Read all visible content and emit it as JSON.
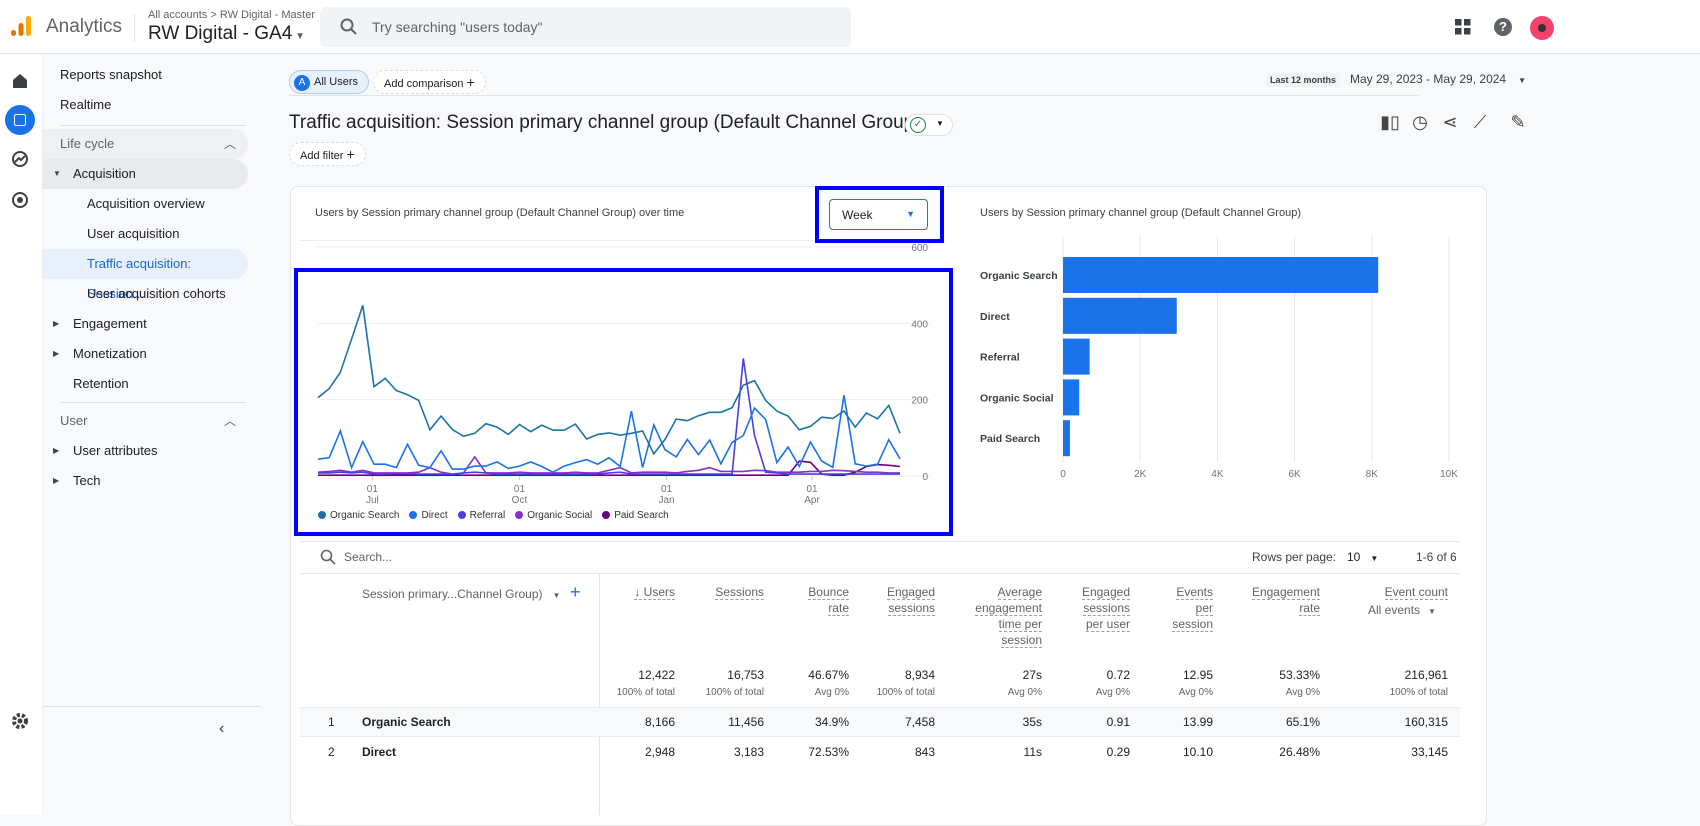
{
  "header": {
    "app_name": "Analytics",
    "breadcrumb": "All accounts > RW Digital - Master",
    "property": "RW Digital - GA4",
    "search_placeholder": "Try searching \"users today\"",
    "icons": [
      "apps-grid-icon",
      "help-icon",
      "avatar"
    ]
  },
  "sidebar": {
    "items": [
      {
        "label": "Reports snapshot"
      },
      {
        "label": "Realtime"
      },
      {
        "label": "Life cycle"
      },
      {
        "label": "Acquisition"
      },
      {
        "label": "Acquisition overview"
      },
      {
        "label": "User acquisition"
      },
      {
        "label": "Traffic acquisition: Session..."
      },
      {
        "label": "User acquisition cohorts"
      },
      {
        "label": "Engagement"
      },
      {
        "label": "Monetization"
      },
      {
        "label": "Retention"
      },
      {
        "label": "User"
      },
      {
        "label": "User attributes"
      },
      {
        "label": "Tech"
      }
    ],
    "collapse_icon": "chevron-left-icon"
  },
  "toolbar": {
    "segment_letter": "A",
    "segment": "All Users",
    "add_comparison": "Add comparison",
    "date_chip": "Last 12 months",
    "date_range": "May 29, 2023 - May 29, 2024"
  },
  "report": {
    "title": "Traffic acquisition: Session primary channel group (Default Channel Group)",
    "add_filter": "Add filter"
  },
  "line_chart_title": "Users by Session primary channel group (Default Channel Group) over time",
  "interval_select": "Week",
  "bar_chart_title": "Users by Session primary channel group (Default Channel Group)",
  "chart_data": [
    {
      "type": "line",
      "ylim": [
        0,
        600
      ],
      "yticks": [
        "0",
        "200",
        "400",
        "600"
      ],
      "xticks": [
        {
          "day": "01",
          "month": "Jul",
          "date": "2023-07-01"
        },
        {
          "day": "01",
          "month": "Oct",
          "date": "2023-10-01"
        },
        {
          "day": "01",
          "month": "Jan",
          "date": "2024-01-01"
        },
        {
          "day": "01",
          "month": "Apr",
          "date": "2024-04-01"
        }
      ],
      "x_start": "2023-05-28",
      "x_interval": "week",
      "grid": true,
      "legend": "bottom",
      "series": [
        {
          "name": "Organic Search",
          "color": "#1a73a8",
          "values": [
            205,
            229,
            272,
            359,
            447,
            234,
            256,
            224,
            213,
            198,
            121,
            157,
            122,
            104,
            112,
            137,
            128,
            109,
            135,
            116,
            133,
            120,
            120,
            136,
            97,
            109,
            113,
            107,
            112,
            118,
            58,
            96,
            149,
            145,
            158,
            167,
            167,
            179,
            238,
            250,
            198,
            170,
            157,
            121,
            130,
            154,
            151,
            170,
            128,
            165,
            150,
            185,
            112
          ]
        },
        {
          "name": "Direct",
          "color": "#1a73e8",
          "values": [
            44,
            48,
            118,
            22,
            90,
            31,
            31,
            22,
            83,
            28,
            22,
            66,
            18,
            18,
            26,
            26,
            37,
            20,
            26,
            37,
            25,
            10,
            26,
            35,
            43,
            31,
            48,
            25,
            170,
            22,
            134,
            69,
            50,
            96,
            56,
            94,
            32,
            88,
            106,
            178,
            148,
            35,
            76,
            25,
            89,
            39,
            23,
            212,
            32,
            26,
            31,
            95,
            45
          ]
        },
        {
          "name": "Referral",
          "color": "#4a3fe0",
          "values": [
            8,
            8,
            10,
            8,
            10,
            5,
            5,
            6,
            6,
            5,
            5,
            5,
            4,
            8,
            10,
            8,
            5,
            5,
            5,
            5,
            5,
            5,
            5,
            5,
            5,
            5,
            8,
            10,
            5,
            5,
            5,
            5,
            5,
            5,
            5,
            5,
            5,
            5,
            308,
            106,
            10,
            8,
            5,
            5,
            5,
            5,
            5,
            5,
            5,
            5,
            5,
            5,
            5
          ]
        },
        {
          "name": "Organic Social",
          "color": "#8430ce",
          "values": [
            10,
            12,
            15,
            10,
            15,
            8,
            8,
            8,
            8,
            10,
            22,
            10,
            5,
            8,
            50,
            8,
            8,
            8,
            10,
            8,
            8,
            8,
            8,
            10,
            8,
            8,
            15,
            22,
            8,
            10,
            10,
            10,
            8,
            12,
            15,
            22,
            12,
            12,
            12,
            15,
            14,
            10,
            10,
            10,
            12,
            12,
            15,
            14,
            12,
            10,
            10,
            8,
            8
          ]
        },
        {
          "name": "Paid Search",
          "color": "#6a0080",
          "values": [
            2,
            2,
            2,
            2,
            2,
            2,
            2,
            2,
            2,
            2,
            2,
            2,
            2,
            2,
            2,
            2,
            2,
            2,
            2,
            2,
            2,
            2,
            2,
            2,
            2,
            2,
            2,
            2,
            2,
            2,
            2,
            2,
            2,
            2,
            2,
            2,
            2,
            2,
            2,
            2,
            2,
            2,
            2,
            39,
            36,
            5,
            2,
            2,
            10,
            25,
            30,
            28,
            25
          ]
        }
      ]
    },
    {
      "type": "bar",
      "orientation": "horizontal",
      "xlim": [
        0,
        10000
      ],
      "xticks": [
        "0",
        "2K",
        "4K",
        "6K",
        "8K",
        "10K"
      ],
      "grid": true,
      "color": "#1a73e8",
      "categories": [
        "Organic Search",
        "Direct",
        "Referral",
        "Organic Social",
        "Paid Search"
      ],
      "values": [
        8166,
        2948,
        690,
        420,
        180
      ]
    }
  ],
  "table": {
    "search_placeholder": "Search...",
    "rows_per_page_label": "Rows per page:",
    "rows_per_page": "10",
    "pagination": "1-6 of 6",
    "dimension_header": "Session primary...Channel Group)",
    "event_filter": "All events",
    "columns": [
      {
        "label": [
          "↓ Users"
        ],
        "total": "12,422",
        "sub": "100% of total"
      },
      {
        "label": [
          "Sessions"
        ],
        "total": "16,753",
        "sub": "100% of total"
      },
      {
        "label": [
          "Bounce",
          "rate"
        ],
        "total": "46.67%",
        "sub": "Avg 0%"
      },
      {
        "label": [
          "Engaged",
          "sessions"
        ],
        "total": "8,934",
        "sub": "100% of total"
      },
      {
        "label": [
          "Average",
          "engagement",
          "time per",
          "session"
        ],
        "total": "27s",
        "sub": "Avg 0%"
      },
      {
        "label": [
          "Engaged",
          "sessions",
          "per user"
        ],
        "total": "0.72",
        "sub": "Avg 0%"
      },
      {
        "label": [
          "Events",
          "per",
          "session"
        ],
        "total": "12.95",
        "sub": "Avg 0%"
      },
      {
        "label": [
          "Engagement",
          "rate"
        ],
        "total": "53.33%",
        "sub": "Avg 0%"
      },
      {
        "label": [
          "Event count"
        ],
        "total": "216,961",
        "sub": "100% of total"
      }
    ],
    "rows": [
      {
        "n": "1",
        "name": "Organic Search",
        "cells": [
          "8,166",
          "11,456",
          "34.9%",
          "7,458",
          "35s",
          "0.91",
          "13.99",
          "65.1%",
          "160,315"
        ]
      },
      {
        "n": "2",
        "name": "Direct",
        "cells": [
          "2,948",
          "3,183",
          "72.53%",
          "843",
          "11s",
          "0.29",
          "10.10",
          "26.48%",
          "33,145"
        ]
      }
    ]
  }
}
